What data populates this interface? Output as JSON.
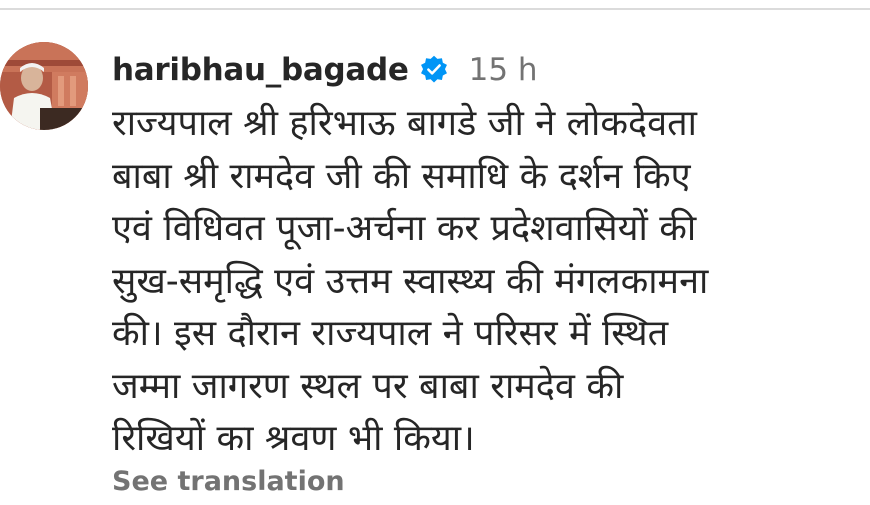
{
  "post": {
    "username": "haribhau_bagade",
    "verified_icon": "verified-badge-icon",
    "timestamp": "15 h",
    "caption_lines": [
      "राज्यपाल श्री हरिभाऊ बागडे  जी ने लोकदेवता",
      "बाबा श्री रामदेव जी की समाधि के दर्शन किए",
      "एवं विधिवत पूजा-अर्चना कर प्रदेशवासियों की",
      "सुख-समृद्धि एवं उत्तम स्वास्थ्य की मंगलकामना",
      "की। इस दौरान राज्यपाल ने परिसर में स्थित",
      "जम्मा जागरण स्थल पर बाबा रामदेव की",
      "रिखियों का श्रवण भी किया।"
    ],
    "see_translation": "See translation"
  },
  "colors": {
    "text": "#262626",
    "muted": "#737373",
    "verified_blue": "#0095f6",
    "divider": "#dbdbdb"
  }
}
